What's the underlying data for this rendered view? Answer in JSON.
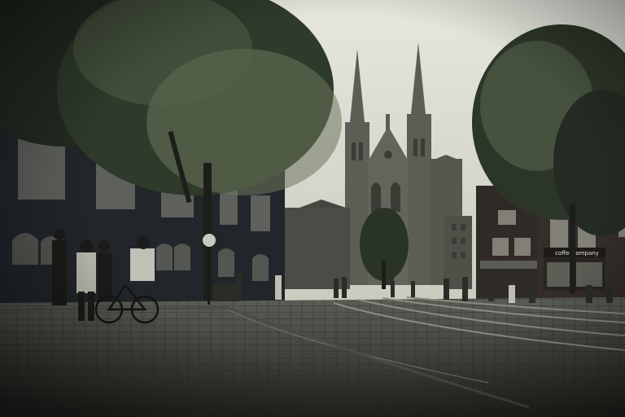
{
  "scene": {
    "subject": "city-square-with-church",
    "tone": "sepia-muted",
    "colors": {
      "sky": "#dcddd3",
      "foliage": "#2e3a2a",
      "foliage_light": "#6d775c",
      "building_dark": "#22262b",
      "church": "#595b52",
      "cobblestone": "#3b3f3a",
      "tram_rail": "#8a8c84"
    }
  },
  "signage": {
    "cafe": "coffeecompany"
  }
}
